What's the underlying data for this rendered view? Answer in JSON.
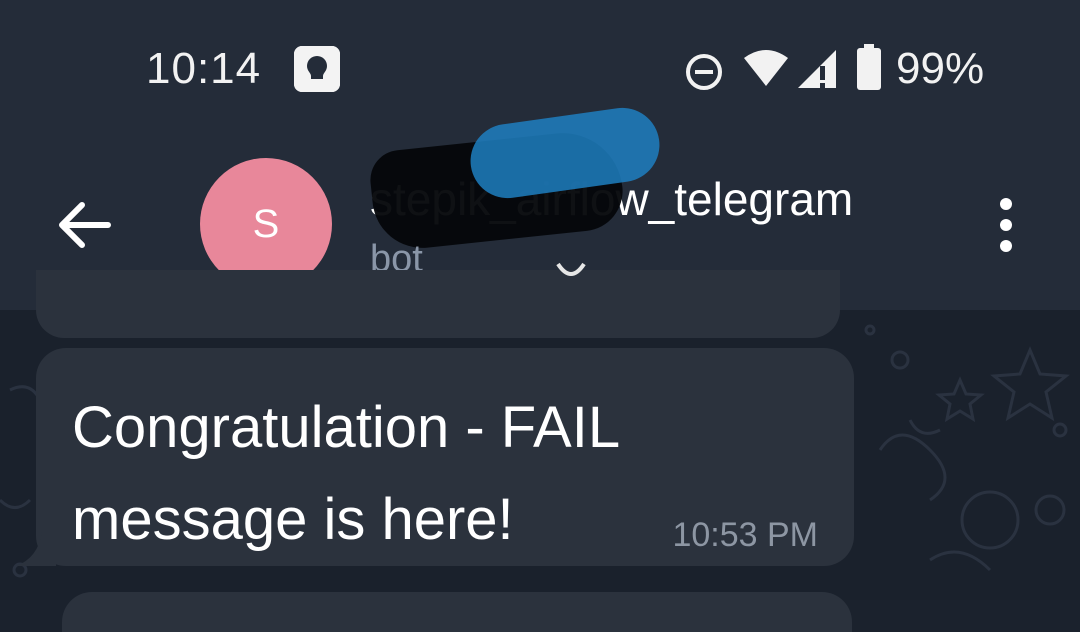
{
  "status_bar": {
    "time": "10:14",
    "battery": "99%",
    "icons": [
      "app-notification-icon",
      "do-not-disturb-icon",
      "wifi-icon",
      "signal-icon",
      "battery-icon"
    ]
  },
  "header": {
    "back_icon": "arrow-left-icon",
    "avatar_letter": "S",
    "avatar_color": "#e8879a",
    "title": "stepik_airflow_telegram",
    "subtitle": "bot",
    "menu_icon": "more-vertical-icon"
  },
  "messages": [
    {
      "text_line_1": "Congratulation - FAIL",
      "text_line_2": "message is here!",
      "time": "10:53 PM"
    }
  ],
  "colors": {
    "header_bg": "#242c39",
    "chat_bg": "#1a212c",
    "bubble_bg": "#2b323d",
    "muted_text": "#8d96a3"
  }
}
